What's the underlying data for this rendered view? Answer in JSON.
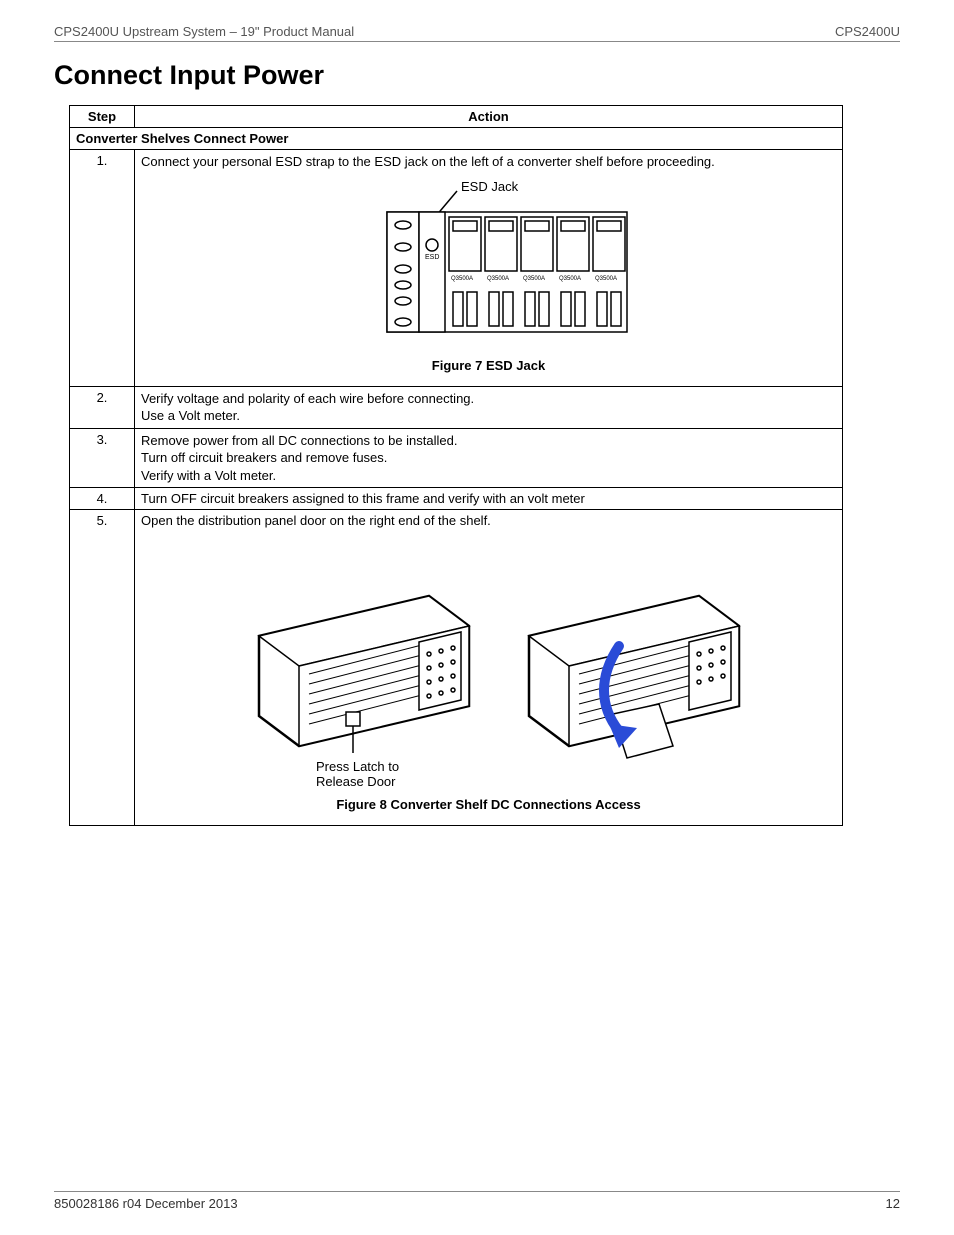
{
  "header": {
    "left": "CPS2400U Upstream System – 19\" Product Manual",
    "right": "CPS2400U"
  },
  "title": "Connect Input Power",
  "table": {
    "col_step": "Step",
    "col_action": "Action",
    "subhead": "Converter Shelves Connect Power",
    "rows": {
      "r1_step": "1.",
      "r1_action": "Connect your personal ESD strap to the ESD jack on the left of a converter shelf before proceeding.",
      "r1_esd_label": "ESD Jack",
      "r1_fig_caption": "Figure 7 ESD Jack",
      "r1_esd_text": "ESD",
      "r1_module_text": "Q3500A",
      "r2_step": "2.",
      "r2_action_l1": "Verify voltage and polarity of each wire before connecting.",
      "r2_action_l2": "Use a Volt meter.",
      "r3_step": "3.",
      "r3_action_l1": "Remove power from all DC connections to be installed.",
      "r3_action_l2": "Turn off circuit breakers and remove fuses.",
      "r3_action_l3": "Verify with a Volt meter.",
      "r4_step": "4.",
      "r4_action": "Turn OFF circuit breakers assigned to this frame and verify with an volt meter",
      "r5_step": "5.",
      "r5_action": "Open the distribution panel door on the right end of the shelf.",
      "r5_press_l1": "Press Latch to",
      "r5_press_l2": "Release Door",
      "r5_fig_caption": "Figure 8 Converter Shelf DC Connections Access"
    }
  },
  "footer": {
    "left": "850028186  r04   December 2013",
    "right": "12"
  }
}
